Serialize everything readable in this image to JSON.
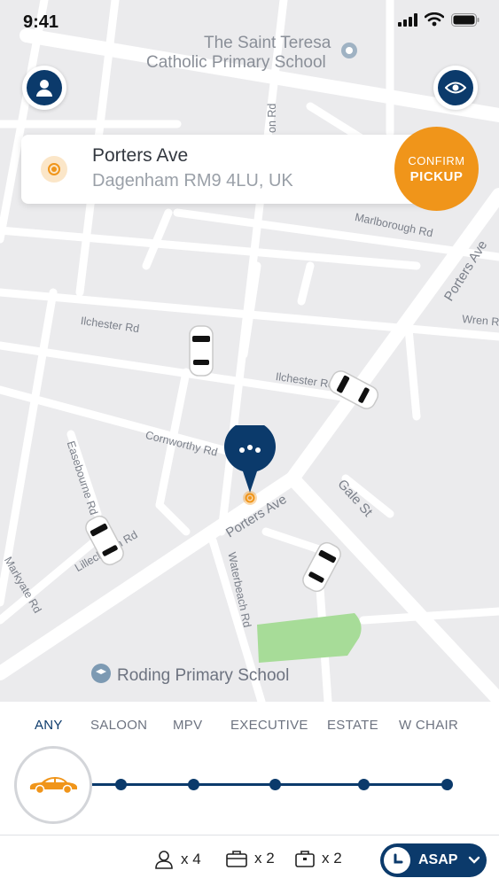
{
  "status_bar": {
    "time": "9:41"
  },
  "map": {
    "poi": [
      {
        "id": "school-1-line1",
        "text": "The Saint Teresa"
      },
      {
        "id": "school-1-line2",
        "text": "Catholic Primary School"
      },
      {
        "id": "school-2",
        "text": "Roding Primary School"
      }
    ],
    "roads": {
      "marlborough": "Marlborough Rd",
      "porters_ave_ne": "Porters Ave",
      "wren": "Wren Rd",
      "ilchester_1": "Ilchester Rd",
      "ilchester_2": "Ilchester Rd",
      "cornworthy": "Cornworthy Rd",
      "easebourne": "Easebourne Rd",
      "lillechurch": "Lillechurch Rd",
      "porters_ave": "Porters Ave",
      "gale": "Gale St",
      "markyate": "Markyate Rd",
      "waterbeach": "Waterbeach Rd",
      "top_partial": "on Rd"
    },
    "colors": {
      "pin": "#0b3a6b",
      "pickup": "#f0951a"
    }
  },
  "pickup": {
    "street": "Porters Ave",
    "area": "Dagenham RM9 4LU, UK",
    "confirm_line1": "CONFIRM",
    "confirm_line2": "PICKUP"
  },
  "vehicle_types": {
    "tabs": [
      "ANY",
      "SALOON",
      "MPV",
      "EXECUTIVE",
      "ESTATE",
      "W CHAIR"
    ],
    "selected": "ANY"
  },
  "footer": {
    "passengers": "x 4",
    "luggage": "x 2",
    "hand_luggage": "x 2",
    "time_label": "ASAP"
  }
}
